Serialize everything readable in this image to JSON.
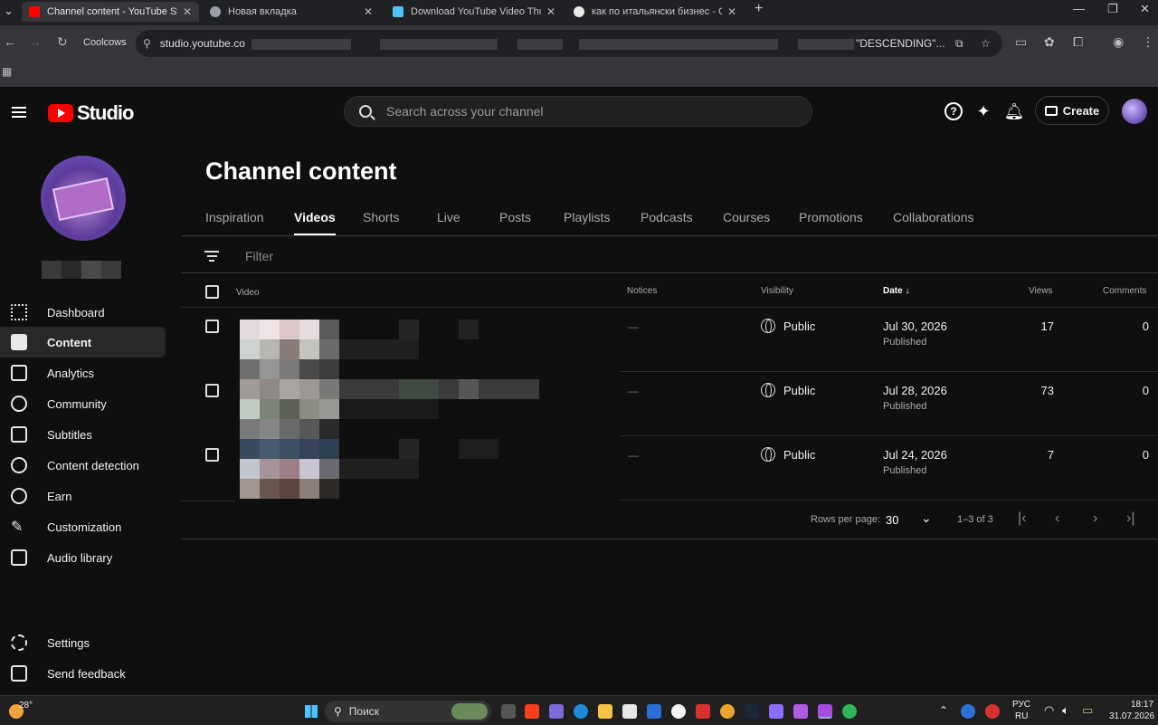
{
  "browser": {
    "tabs": [
      {
        "title": "Channel content - YouTube Stu",
        "active": true,
        "favicon_color": "#ff0000"
      },
      {
        "title": "Новая вкладка",
        "active": false,
        "favicon_color": "#9aa0a6"
      },
      {
        "title": "Download YouTube Video Thum",
        "active": false,
        "favicon_color": "#4fc3f7"
      },
      {
        "title": "как по итальянски бизнес - Go",
        "active": false,
        "favicon_color": "#e8e8e8"
      }
    ],
    "profile_label": "Coolcows",
    "url": "studio.youtube.co",
    "url_tail": "\"DESCENDING\"..."
  },
  "header": {
    "logo_text": "Studio",
    "search_placeholder": "Search across your channel",
    "create_label": "Create"
  },
  "sidebar": {
    "items": [
      {
        "label": "Dashboard",
        "icon": "dashboard-icon"
      },
      {
        "label": "Content",
        "icon": "content-icon",
        "active": true
      },
      {
        "label": "Analytics",
        "icon": "analytics-icon"
      },
      {
        "label": "Community",
        "icon": "community-icon"
      },
      {
        "label": "Subtitles",
        "icon": "subtitles-icon"
      },
      {
        "label": "Content detection",
        "icon": "copyright-icon"
      },
      {
        "label": "Earn",
        "icon": "dollar-icon"
      },
      {
        "label": "Customization",
        "icon": "wand-icon"
      },
      {
        "label": "Audio library",
        "icon": "audio-library-icon"
      }
    ],
    "footer": [
      {
        "label": "Settings",
        "icon": "gear-icon"
      },
      {
        "label": "Send feedback",
        "icon": "feedback-icon"
      }
    ]
  },
  "main": {
    "title": "Channel content",
    "tabs": [
      "Inspiration",
      "Videos",
      "Shorts",
      "Live",
      "Posts",
      "Playlists",
      "Podcasts",
      "Courses",
      "Promotions",
      "Collaborations"
    ],
    "active_tab": "Videos",
    "filter_placeholder": "Filter",
    "columns": {
      "video": "Video",
      "notices": "Notices",
      "visibility": "Visibility",
      "date": "Date",
      "views": "Views",
      "comments": "Comments"
    },
    "rows": [
      {
        "notices": "—",
        "visibility": "Public",
        "date": "Jul 30, 2026",
        "status": "Published",
        "views": "17",
        "comments": "0"
      },
      {
        "notices": "—",
        "visibility": "Public",
        "date": "Jul 28, 2026",
        "status": "Published",
        "views": "73",
        "comments": "0"
      },
      {
        "notices": "—",
        "visibility": "Public",
        "date": "Jul 24, 2026",
        "status": "Published",
        "views": "7",
        "comments": "0"
      }
    ],
    "pagination": {
      "rows_per_page_label": "Rows per page:",
      "rows_per_page": "30",
      "range": "1–3 of 3"
    }
  },
  "taskbar": {
    "weather": "28°",
    "search_label": "Поиск",
    "lang_top": "РУС",
    "lang_bottom": "RU",
    "time": "18:17",
    "date": "31.07.2026"
  }
}
